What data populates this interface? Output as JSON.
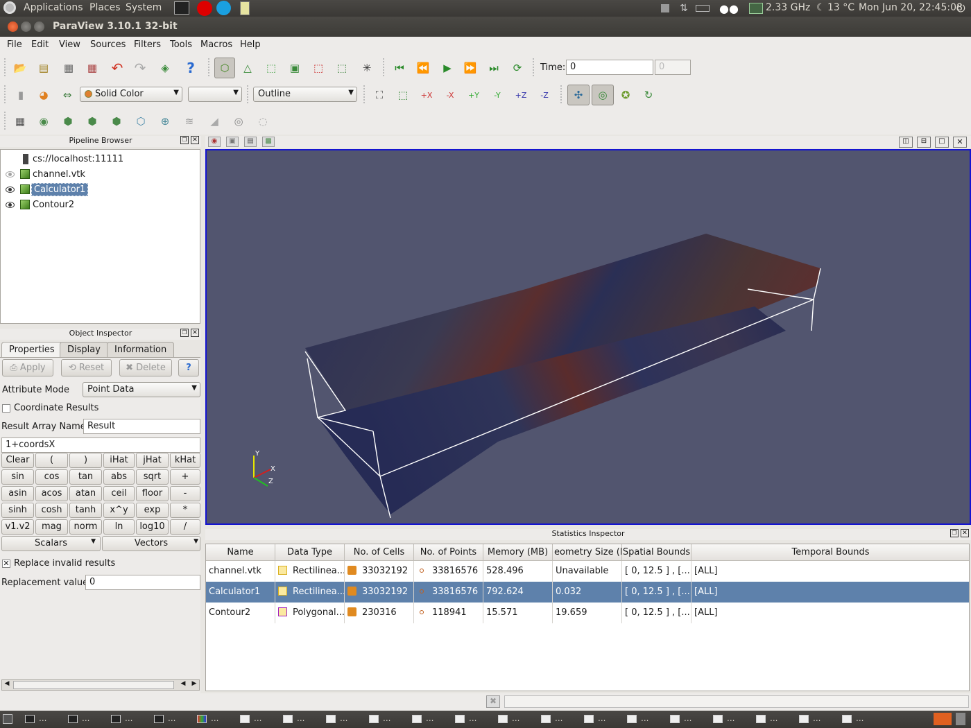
{
  "top_panel": {
    "applications": "Applications",
    "places": "Places",
    "system": "System",
    "cpu": "2.33 GHz",
    "weather": "13 °C",
    "clock": "Mon Jun 20, 22:45:08"
  },
  "window": {
    "title": "ParaView 3.10.1 32-bit"
  },
  "menu": [
    "File",
    "Edit",
    "View",
    "Sources",
    "Filters",
    "Tools",
    "Macros",
    "Help"
  ],
  "toolbar": {
    "time_label": "Time:",
    "time_value": "0",
    "time_step": "0",
    "color_by": "Solid Color",
    "representation": "Outline",
    "component": ""
  },
  "pipeline": {
    "header": "Pipeline Browser",
    "server": "cs://localhost:11111",
    "items": [
      "channel.vtk",
      "Calculator1",
      "Contour2"
    ]
  },
  "inspector": {
    "header": "Object Inspector",
    "tabs": [
      "Properties",
      "Display",
      "Information"
    ],
    "apply": "Apply",
    "reset": "Reset",
    "delete": "Delete",
    "help": "?",
    "attribute_mode_label": "Attribute Mode",
    "attribute_mode": "Point Data",
    "coordinate_results": "Coordinate Results",
    "result_array_label": "Result Array Name",
    "result_array": "Result",
    "expression": "1+coordsX",
    "calc_buttons": [
      "Clear",
      "(",
      ")",
      "iHat",
      "jHat",
      "kHat",
      "sin",
      "cos",
      "tan",
      "abs",
      "sqrt",
      "+",
      "asin",
      "acos",
      "atan",
      "ceil",
      "floor",
      "-",
      "sinh",
      "cosh",
      "tanh",
      "x^y",
      "exp",
      "*",
      "v1.v2",
      "mag",
      "norm",
      "ln",
      "log10",
      "/"
    ],
    "scalars": "Scalars",
    "vectors": "Vectors",
    "replace_invalid": "Replace invalid results",
    "replacement_label": "Replacement value",
    "replacement_value": "0"
  },
  "axes": {
    "y": "Y",
    "x": "X",
    "z": "Z"
  },
  "stats": {
    "header": "Statistics Inspector",
    "columns": [
      "Name",
      "Data Type",
      "No. of Cells",
      "No. of Points",
      "Memory (MB)",
      "eometry Size (M",
      "Spatial Bounds",
      "Temporal Bounds"
    ],
    "rows": [
      [
        "channel.vtk",
        "Rectilinea...",
        "33032192",
        "33816576",
        "528.496",
        "Unavailable",
        "[ 0, 12.5 ] , [...",
        "[ALL]"
      ],
      [
        "Calculator1",
        "Rectilinea...",
        "33032192",
        "33816576",
        "792.624",
        "0.032",
        "[ 0, 12.5 ] , [...",
        "[ALL]"
      ],
      [
        "Contour2",
        "Polygonal...",
        "230316",
        "118941",
        "15.571",
        "19.659",
        "[ 0, 12.5 ] , [...",
        "[ALL]"
      ]
    ]
  },
  "taskbar": [
    "...",
    "...",
    "...",
    "...",
    "...",
    "...",
    "...",
    "...",
    "...",
    "...",
    "...",
    "...",
    "...",
    "...",
    "...",
    "...",
    "...",
    "...",
    "...",
    "..."
  ]
}
